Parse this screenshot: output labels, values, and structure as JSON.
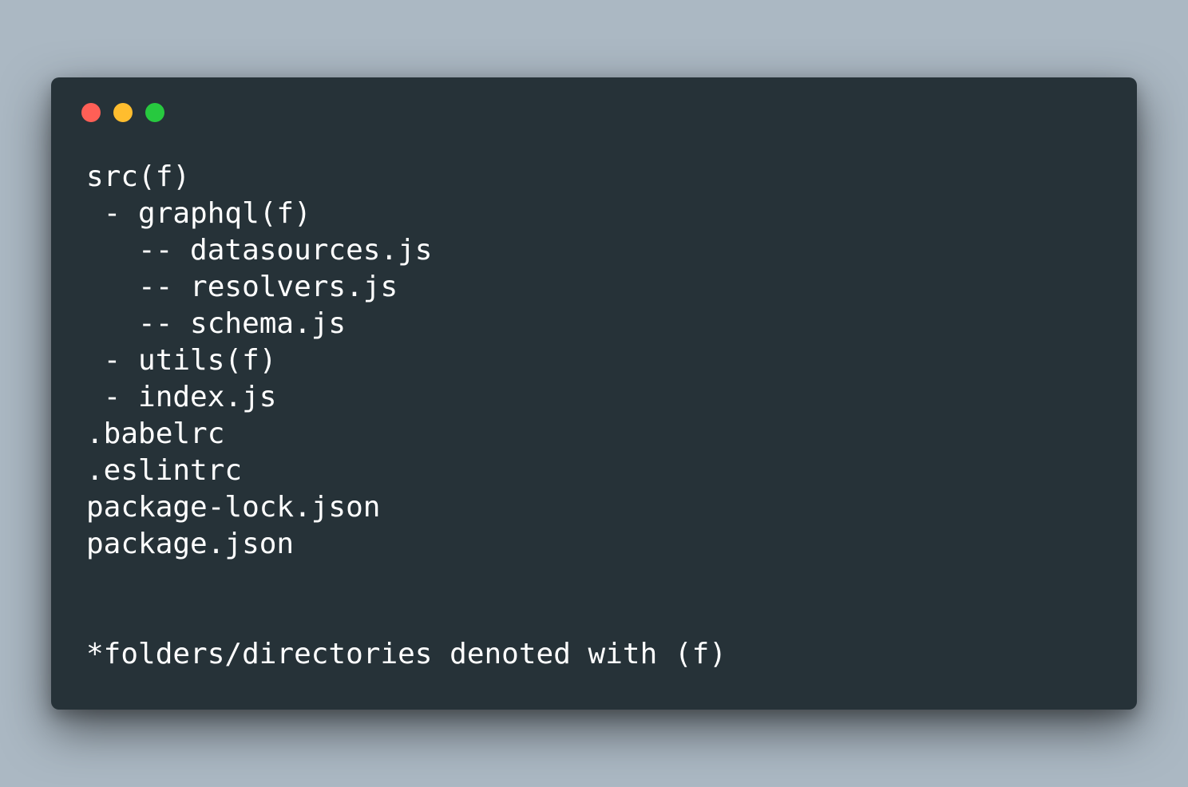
{
  "window": {
    "background": "#263238",
    "controls": [
      {
        "name": "close",
        "color": "#ff5f56"
      },
      {
        "name": "minimize",
        "color": "#ffbd2e"
      },
      {
        "name": "maximize",
        "color": "#27c93f"
      }
    ]
  },
  "code": {
    "lines": [
      "src(f)",
      " - graphql(f)",
      "   -- datasources.js",
      "   -- resolvers.js",
      "   -- schema.js",
      " - utils(f)",
      " - index.js",
      ".babelrc",
      ".eslintrc",
      "package-lock.json",
      "package.json",
      "",
      "",
      "*folders/directories denoted with (f)"
    ]
  }
}
